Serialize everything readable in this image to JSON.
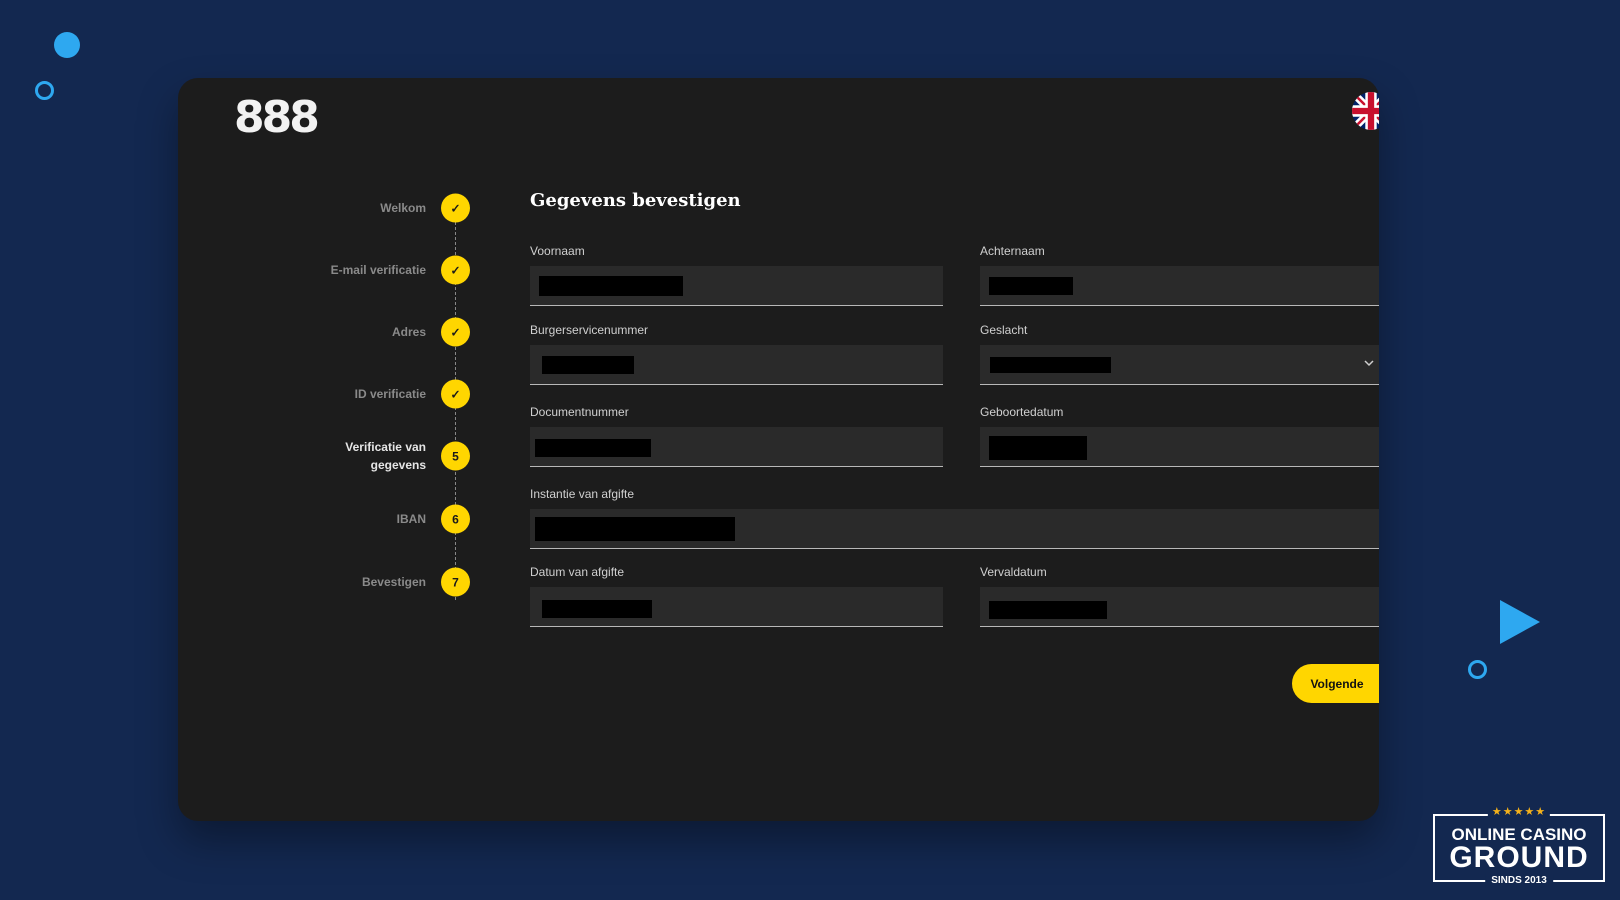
{
  "app": {
    "logo": "888"
  },
  "language": {
    "icon": "uk-flag-icon"
  },
  "stepper": {
    "steps": [
      {
        "label": "Welkom",
        "status": "done",
        "marker": "✓"
      },
      {
        "label": "E-mail verificatie",
        "status": "done",
        "marker": "✓"
      },
      {
        "label": "Adres",
        "status": "done",
        "marker": "✓"
      },
      {
        "label": "ID verificatie",
        "status": "done",
        "marker": "✓"
      },
      {
        "label": "Verificatie van gegevens",
        "status": "active",
        "marker": "5"
      },
      {
        "label": "IBAN",
        "status": "pending",
        "marker": "6"
      },
      {
        "label": "Bevestigen",
        "status": "pending",
        "marker": "7"
      }
    ]
  },
  "form": {
    "title": "Gegevens bevestigen",
    "fields": {
      "voornaam": {
        "label": "Voornaam",
        "value": ""
      },
      "achternaam": {
        "label": "Achternaam",
        "value": ""
      },
      "bsn": {
        "label": "Burgerservicenummer",
        "value": ""
      },
      "geslacht": {
        "label": "Geslacht",
        "value": ""
      },
      "documentnummer": {
        "label": "Documentnummer",
        "value": ""
      },
      "geboortedatum": {
        "label": "Geboortedatum",
        "value": ""
      },
      "instantie": {
        "label": "Instantie van afgifte",
        "value": ""
      },
      "datum_afgifte": {
        "label": "Datum van afgifte",
        "value": ""
      },
      "vervaldatum": {
        "label": "Vervaldatum",
        "value": ""
      }
    },
    "next_label": "Volgende"
  },
  "brand_badge": {
    "stars": "★★★★★",
    "line1": "ONLINE CASINO",
    "line2": "GROUND",
    "line3": "SINDS 2013"
  },
  "colors": {
    "background": "#132850",
    "card": "#1c1c1c",
    "accent": "#ffd600",
    "decor": "#2ea8f0"
  }
}
